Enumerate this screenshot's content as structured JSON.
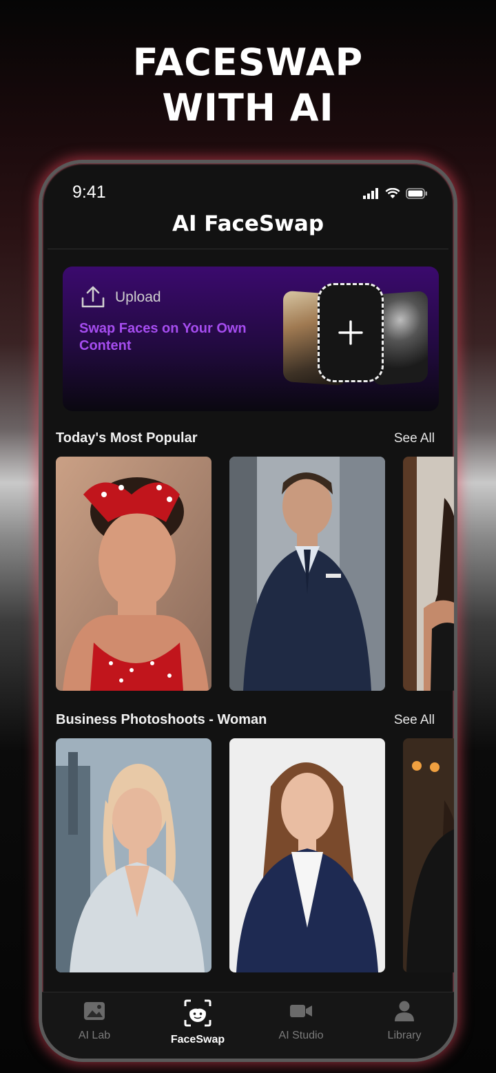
{
  "promo": {
    "line1": "FACESWAP",
    "line2": "WITH AI"
  },
  "status_bar": {
    "time": "9:41"
  },
  "header": {
    "title": "AI FaceSwap"
  },
  "upload_card": {
    "label": "Upload",
    "subtitle": "Swap Faces on Your Own Content"
  },
  "sections": [
    {
      "title": "Today's Most Popular",
      "see_all": "See All",
      "items": [
        "woman-red-polka-dot-bow",
        "man-navy-suit",
        "woman-black-top"
      ]
    },
    {
      "title": "Business Photoshoots - Woman",
      "see_all": "See All",
      "items": [
        "woman-white-blazer",
        "woman-navy-blazer",
        "woman-black-blazer"
      ]
    }
  ],
  "tabs": [
    {
      "label": "AI Lab",
      "icon": "image-icon",
      "active": false
    },
    {
      "label": "FaceSwap",
      "icon": "face-scan-icon",
      "active": true
    },
    {
      "label": "AI Studio",
      "icon": "video-camera-icon",
      "active": false
    },
    {
      "label": "Library",
      "icon": "user-icon",
      "active": false
    }
  ],
  "colors": {
    "accent_purple": "#a64df0",
    "card_gradient_top": "#3b0a6e",
    "glow_red": "#e6465a",
    "background": "#121212"
  }
}
